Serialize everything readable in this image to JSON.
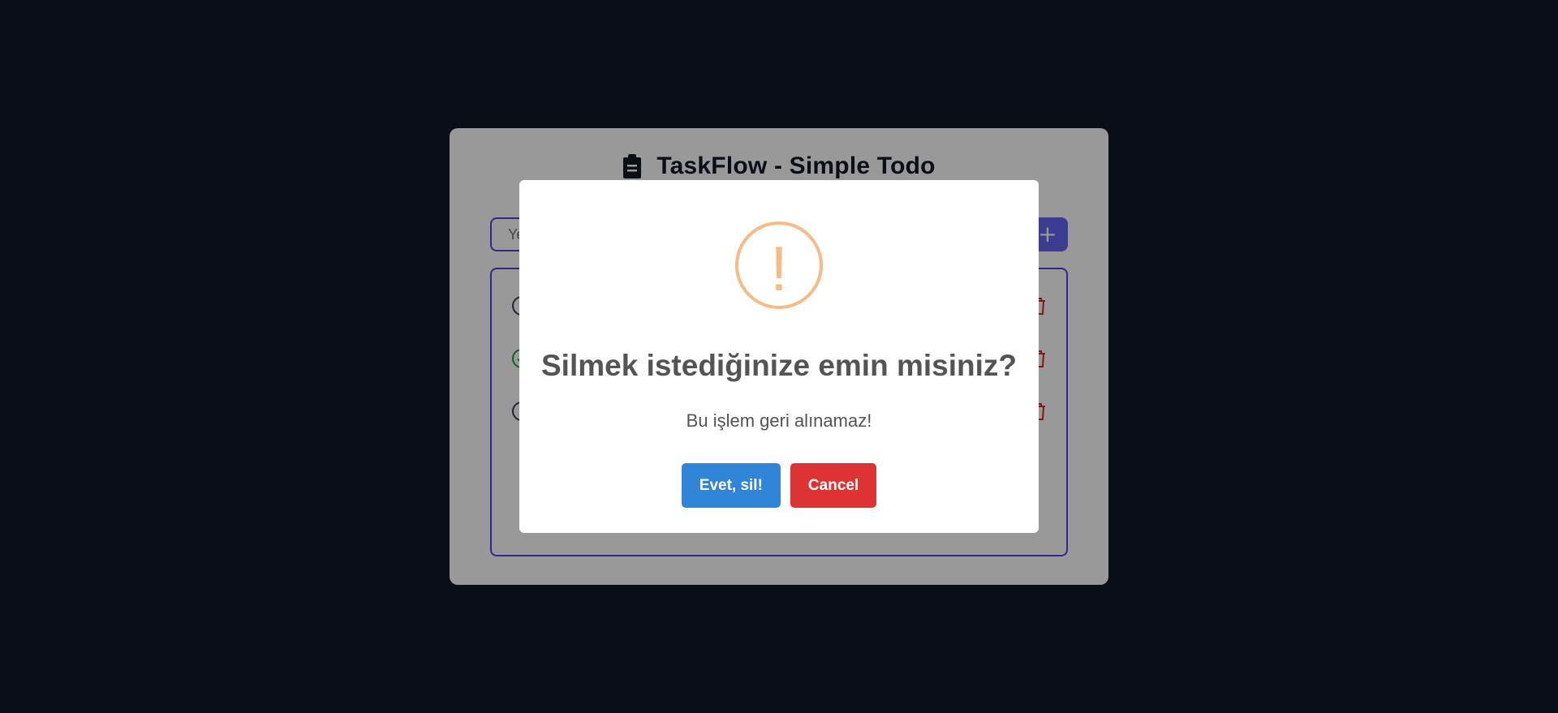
{
  "app": {
    "title": "TaskFlow - Simple Todo",
    "input_placeholder": "Yeni görev ekle...",
    "add_button_label": "+"
  },
  "todos": [
    {
      "text": "",
      "completed": false
    },
    {
      "text": "",
      "completed": true
    },
    {
      "text": "",
      "completed": false
    }
  ],
  "dialog": {
    "icon": "warning-icon",
    "icon_glyph": "!",
    "title": "Silmek istediğinize emin misiniz?",
    "text": "Bu işlem geri alınamaz!",
    "confirm_label": "Evet, sil!",
    "cancel_label": "Cancel"
  },
  "colors": {
    "background": "#111827",
    "accent": "#4f46e5",
    "confirm": "#3085d6",
    "cancel": "#dd3333",
    "warning": "#f8bb86",
    "completed": "#16a34a",
    "delete": "#dc2626"
  }
}
